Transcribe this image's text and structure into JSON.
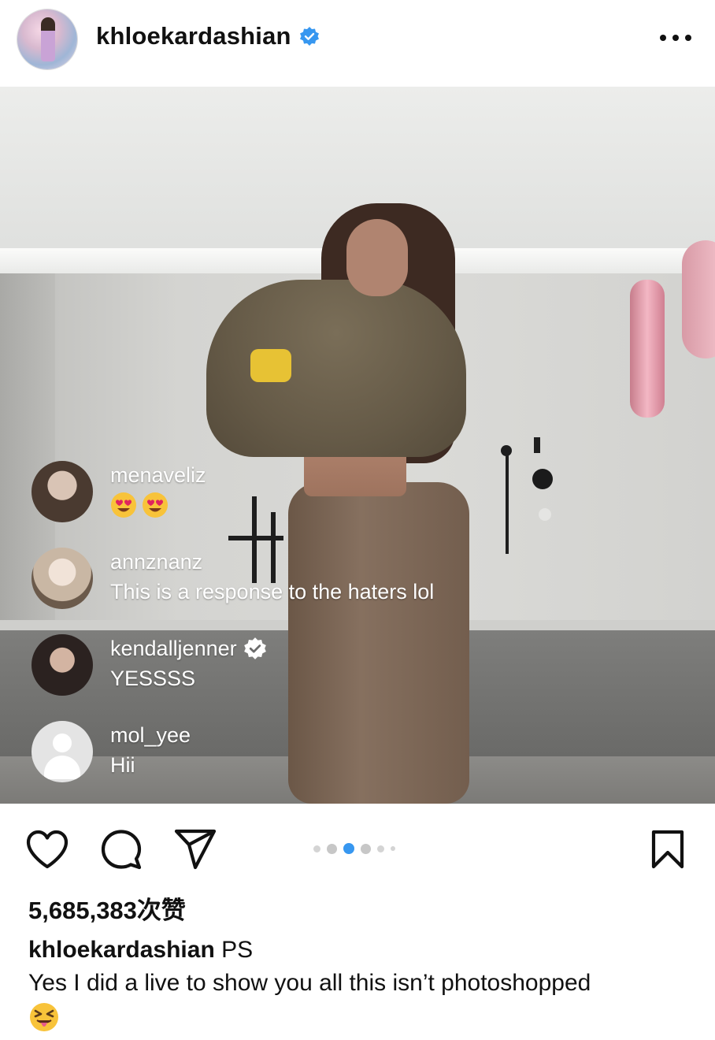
{
  "post": {
    "username": "khloekardashian",
    "verified": true,
    "more_icon": "more-horizontal-icon"
  },
  "live_comments": [
    {
      "user": "menaveliz",
      "message": "",
      "emoji": "heart-eyes-emoji x2"
    },
    {
      "user": "annznanz",
      "message": "This is a response to the haters lol"
    },
    {
      "user": "kendalljenner",
      "verified": true,
      "message": "YESSSS"
    },
    {
      "user": "mol_yee",
      "message": "Hii"
    }
  ],
  "actions": {
    "like_icon": "heart-icon",
    "comment_icon": "comment-icon",
    "share_icon": "send-icon",
    "save_icon": "bookmark-icon",
    "carousel_active_index": 3,
    "carousel_count": 6
  },
  "likes_text": "5,685,383次赞",
  "caption": {
    "username": "khloekardashian",
    "line1": "PS",
    "line2": "Yes I did a live to show you all this isn’t photoshopped",
    "emoji": "squinting-face-with-tongue"
  },
  "colors": {
    "verified_blue": "#3797f0",
    "carousel_active": "#3797f0",
    "carousel_inactive": "#c7c7c7"
  }
}
